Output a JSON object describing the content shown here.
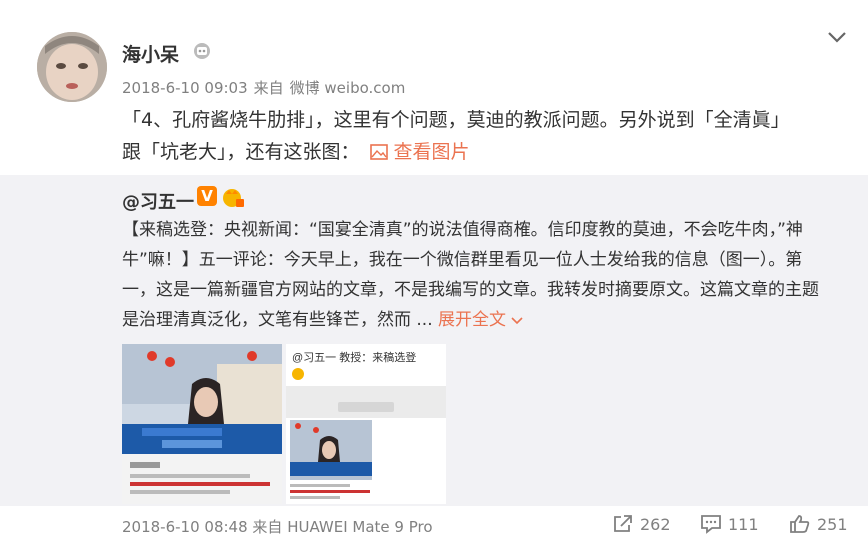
{
  "post": {
    "author": "海小呆",
    "time": "2018-6-10 09:03",
    "from_label": "来自",
    "source": "微博 weibo.com",
    "text_line1": "「4、孔府酱烧牛肋排」，这里有个问题，莫迪的教派问题。另外说到「全清眞」",
    "text_line2": "跟「坑老大」，还有这张图：",
    "view_pic_label": "查看图片"
  },
  "repost": {
    "author": "@习五一",
    "v_label": "V",
    "text_line1": "【来稿选登：央视新闻：“国宴全清真”的说法值得商榷。信印度教的莫迪，不会吃牛肉，”神",
    "text_line2": "牛”嘛！】五一评论：今天早上，我在一个微信群里看见一位人士发给我的信息（图一）。第",
    "text_line3": "一，这是一篇新疆官方网站的文章，不是我编写的文章。我转发时摘要原文。这篇文章的主题",
    "text_line4": "是治理清真泛化，文笔有些锋芒，然而 ...",
    "expand_label": "展开全文",
    "thumb2_header": "@习五一   教授：来稿选登"
  },
  "footer": {
    "time": "2018-6-10 08:48",
    "from_label": "来自",
    "source": "HUAWEI Mate 9 Pro"
  },
  "actions": {
    "repost_count": "262",
    "comment_count": "111",
    "like_count": "251"
  },
  "colors": {
    "accent": "#eb7350",
    "vbadge": "#ff8200",
    "repost_bg": "#f2f2f5"
  }
}
